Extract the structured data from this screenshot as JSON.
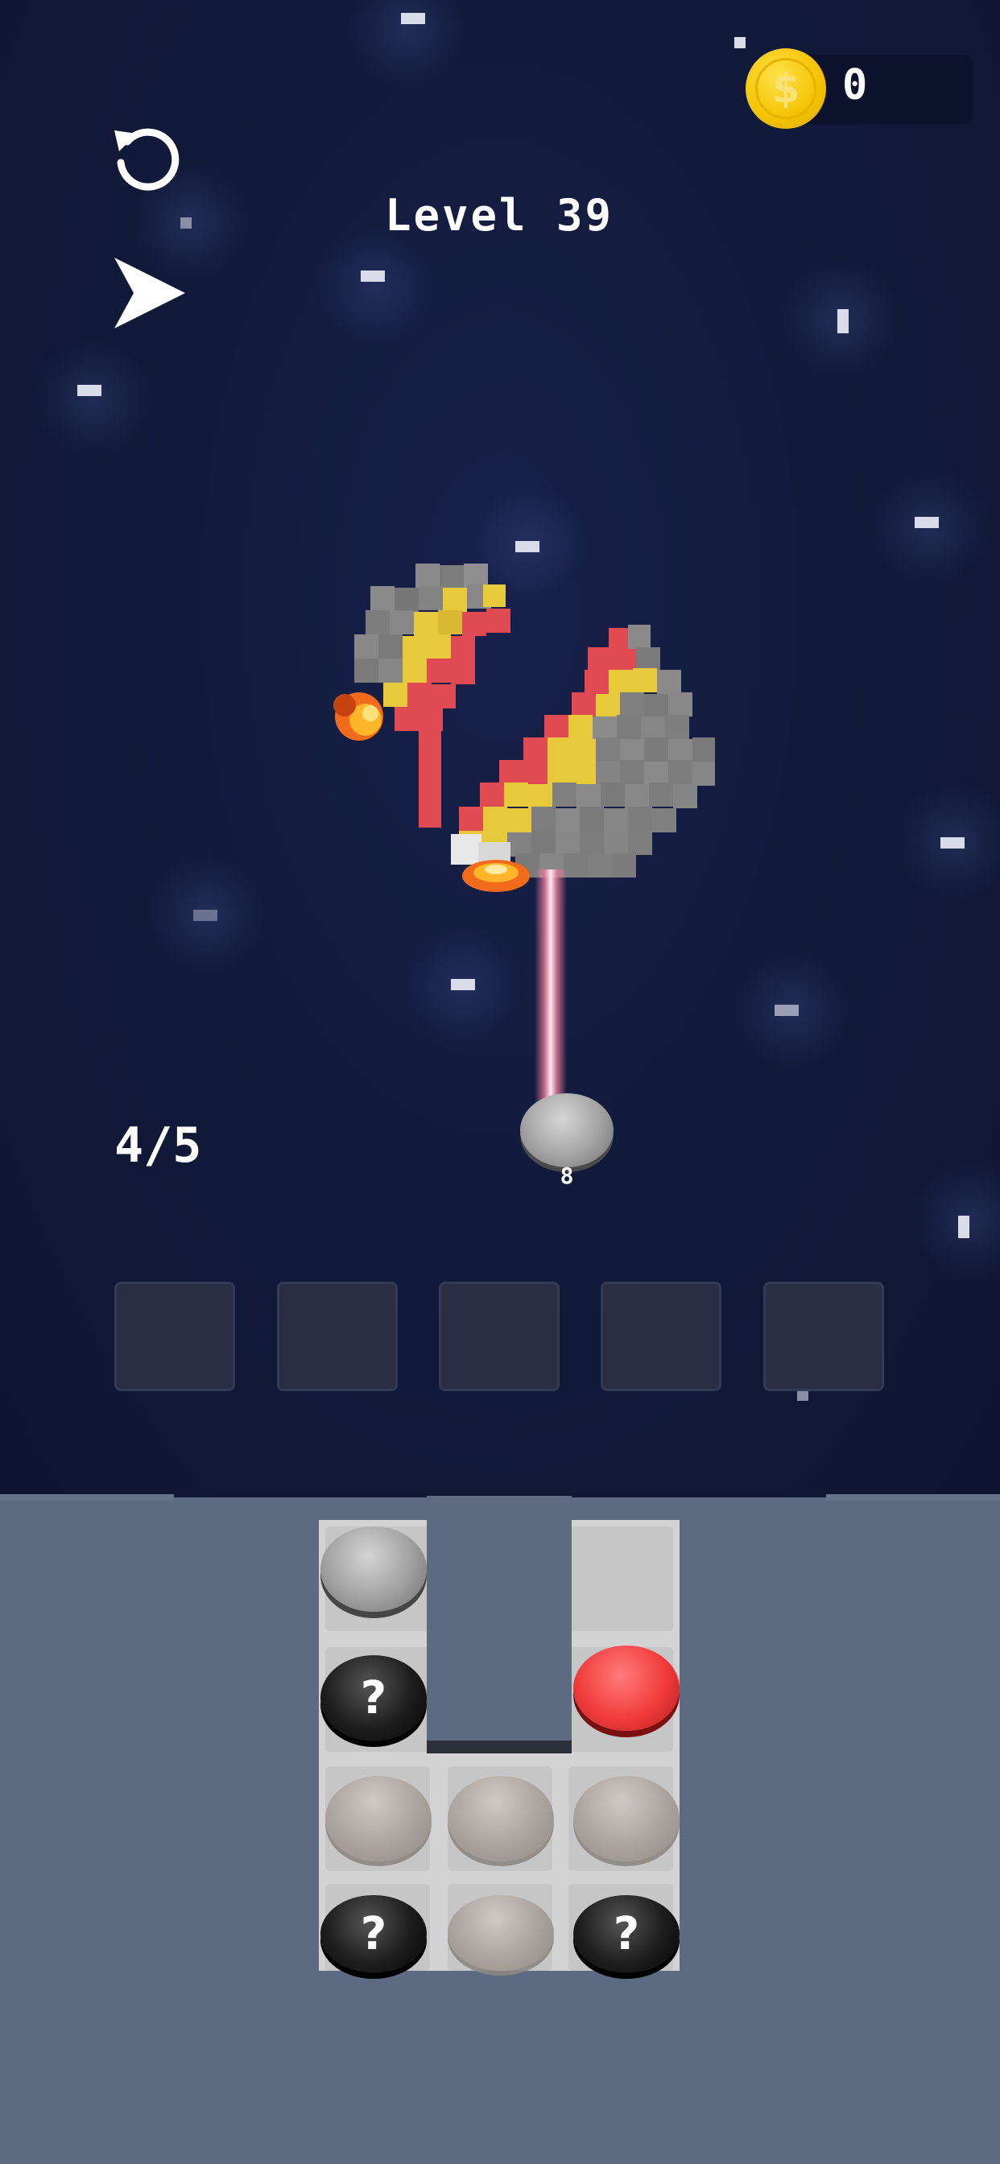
{
  "header": {
    "level_title": "Level 39",
    "coins": "0",
    "coin_symbol": "$"
  },
  "controls": {
    "restart_icon": "restart-icon",
    "skip_icon": "skip-arrow-icon"
  },
  "shots": {
    "label": "4/5"
  },
  "shooter": {
    "color": "gray",
    "ammo": "8"
  },
  "slots": {
    "count": 5
  },
  "grid": {
    "cells": [
      {
        "row": 1,
        "col": 1,
        "type": "gray",
        "label": ""
      },
      {
        "row": 2,
        "col": 1,
        "type": "mystery",
        "label": "?"
      },
      {
        "row": 2,
        "col": 3,
        "type": "red",
        "label": ""
      },
      {
        "row": 3,
        "col": 1,
        "type": "ghost",
        "label": ""
      },
      {
        "row": 3,
        "col": 2,
        "type": "ghost",
        "label": ""
      },
      {
        "row": 3,
        "col": 3,
        "type": "ghost",
        "label": ""
      },
      {
        "row": 4,
        "col": 1,
        "type": "mystery",
        "label": "?"
      },
      {
        "row": 4,
        "col": 2,
        "type": "ghost",
        "label": ""
      },
      {
        "row": 4,
        "col": 3,
        "type": "mystery",
        "label": "?"
      }
    ]
  },
  "colors": {
    "background": "#121a3a",
    "tray": "#5d6b82",
    "coin": "#f4c200",
    "red_pixel": "#e04a52",
    "yellow_pixel": "#e8c93c",
    "gray_pixel": "#7b7b7b"
  }
}
